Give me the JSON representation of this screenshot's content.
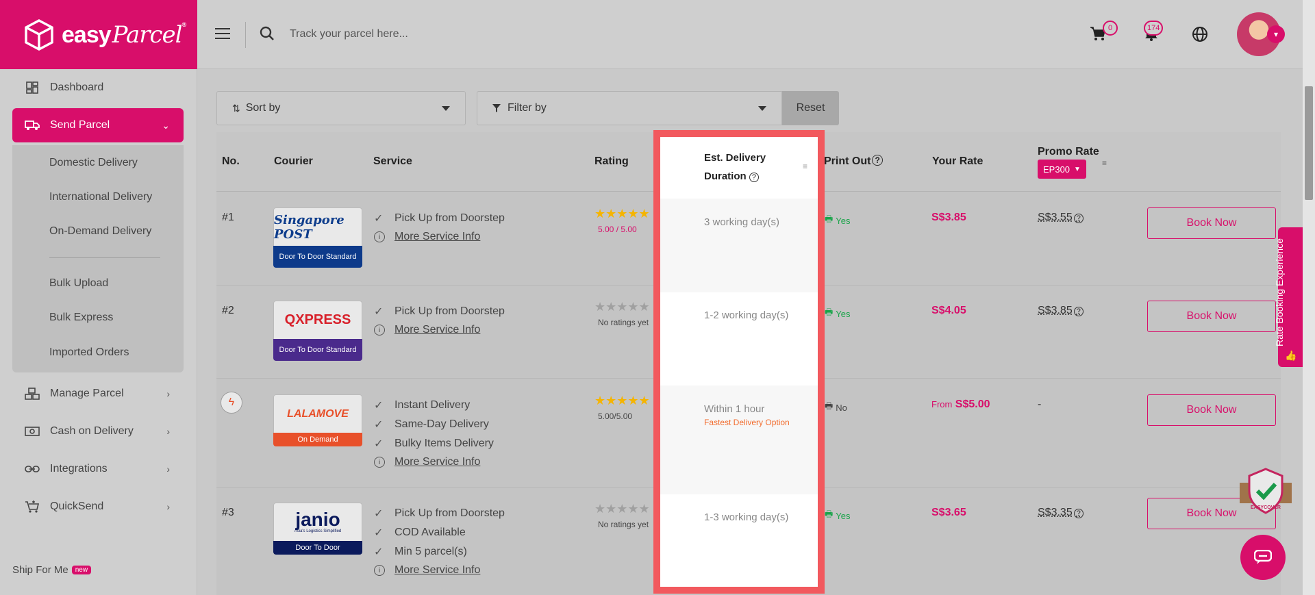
{
  "brand": {
    "name": "easy",
    "name_script": "Parcel",
    "mark": "®"
  },
  "search": {
    "placeholder": "Track your parcel here..."
  },
  "topbar": {
    "cart_count": "0",
    "notif_count": "174"
  },
  "colors": {
    "accent": "#d80e6a",
    "highlight_border": "#f2595e",
    "success": "#1aa44a"
  },
  "sidebar": {
    "items": [
      {
        "label": "Dashboard",
        "icon": "dashboard-icon"
      },
      {
        "label": "Send Parcel",
        "icon": "truck-icon"
      },
      {
        "label": "Manage Parcel",
        "icon": "boxes-icon"
      },
      {
        "label": "Cash on Delivery",
        "icon": "cash-icon"
      },
      {
        "label": "Integrations",
        "icon": "link-icon"
      },
      {
        "label": "QuickSend",
        "icon": "cart-plus-icon"
      }
    ],
    "submenu": [
      "Domestic Delivery",
      "International Delivery",
      "On-Demand Delivery",
      "Bulk Upload",
      "Bulk Express",
      "Imported Orders"
    ],
    "ship_for_me": "Ship For Me",
    "new_badge": "new"
  },
  "controls": {
    "sort": "Sort by",
    "filter": "Filter by",
    "reset": "Reset"
  },
  "table": {
    "headers": {
      "no": "No.",
      "courier": "Courier",
      "service": "Service",
      "rating": "Rating",
      "duration_1": "Est. Delivery",
      "duration_2": "Duration",
      "print": "Print Out",
      "rate": "Your Rate",
      "promo": "Promo Rate",
      "promo_code": "EP300"
    },
    "rows": [
      {
        "no": "#1",
        "courier_name": "Singapore POST",
        "tag": "Door To Door Standard",
        "services": [
          "Pick Up from Doorstep"
        ],
        "more": "More Service Info",
        "stars": "★★★★★",
        "rating": "5.00 / 5.00",
        "duration": "3 working day(s)",
        "print": "Yes",
        "rate": "S$3.85",
        "promo": "S$3.55",
        "book": "Book Now"
      },
      {
        "no": "#2",
        "courier_name": "QXPRESS",
        "tag": "Door To Door Standard",
        "services": [
          "Pick Up from Doorstep"
        ],
        "more": "More Service Info",
        "stars": "★★★★★",
        "rating": "No ratings yet",
        "duration": "1-2 working day(s)",
        "print": "Yes",
        "rate": "S$4.05",
        "promo": "S$3.85",
        "book": "Book Now"
      },
      {
        "no": "",
        "courier_name": "LALAMOVE",
        "tag": "On Demand",
        "services": [
          "Instant Delivery",
          "Same-Day Delivery",
          "Bulky Items Delivery"
        ],
        "more": "More Service Info",
        "stars": "★★★★★",
        "rating": "5.00/5.00",
        "duration": "Within 1 hour",
        "duration_note": "Fastest Delivery Option",
        "print": "No",
        "rate_prefix": "From",
        "rate": "S$5.00",
        "promo": "-",
        "book": "Book Now"
      },
      {
        "no": "#3",
        "courier_name": "janio",
        "courier_sub": "Asia's Logistics Simplified",
        "tag": "Door To Door",
        "services": [
          "Pick Up from Doorstep",
          "COD Available",
          "Min 5 parcel(s)"
        ],
        "more": "More Service Info",
        "stars": "★★★★★",
        "rating": "No ratings yet",
        "duration": "1-3 working day(s)",
        "print": "Yes",
        "rate": "S$3.65",
        "promo": "S$3.35",
        "book": "Book Now"
      }
    ]
  },
  "side_tab": "Rate Booking Experience",
  "cover_badge": "EASYCOVER"
}
